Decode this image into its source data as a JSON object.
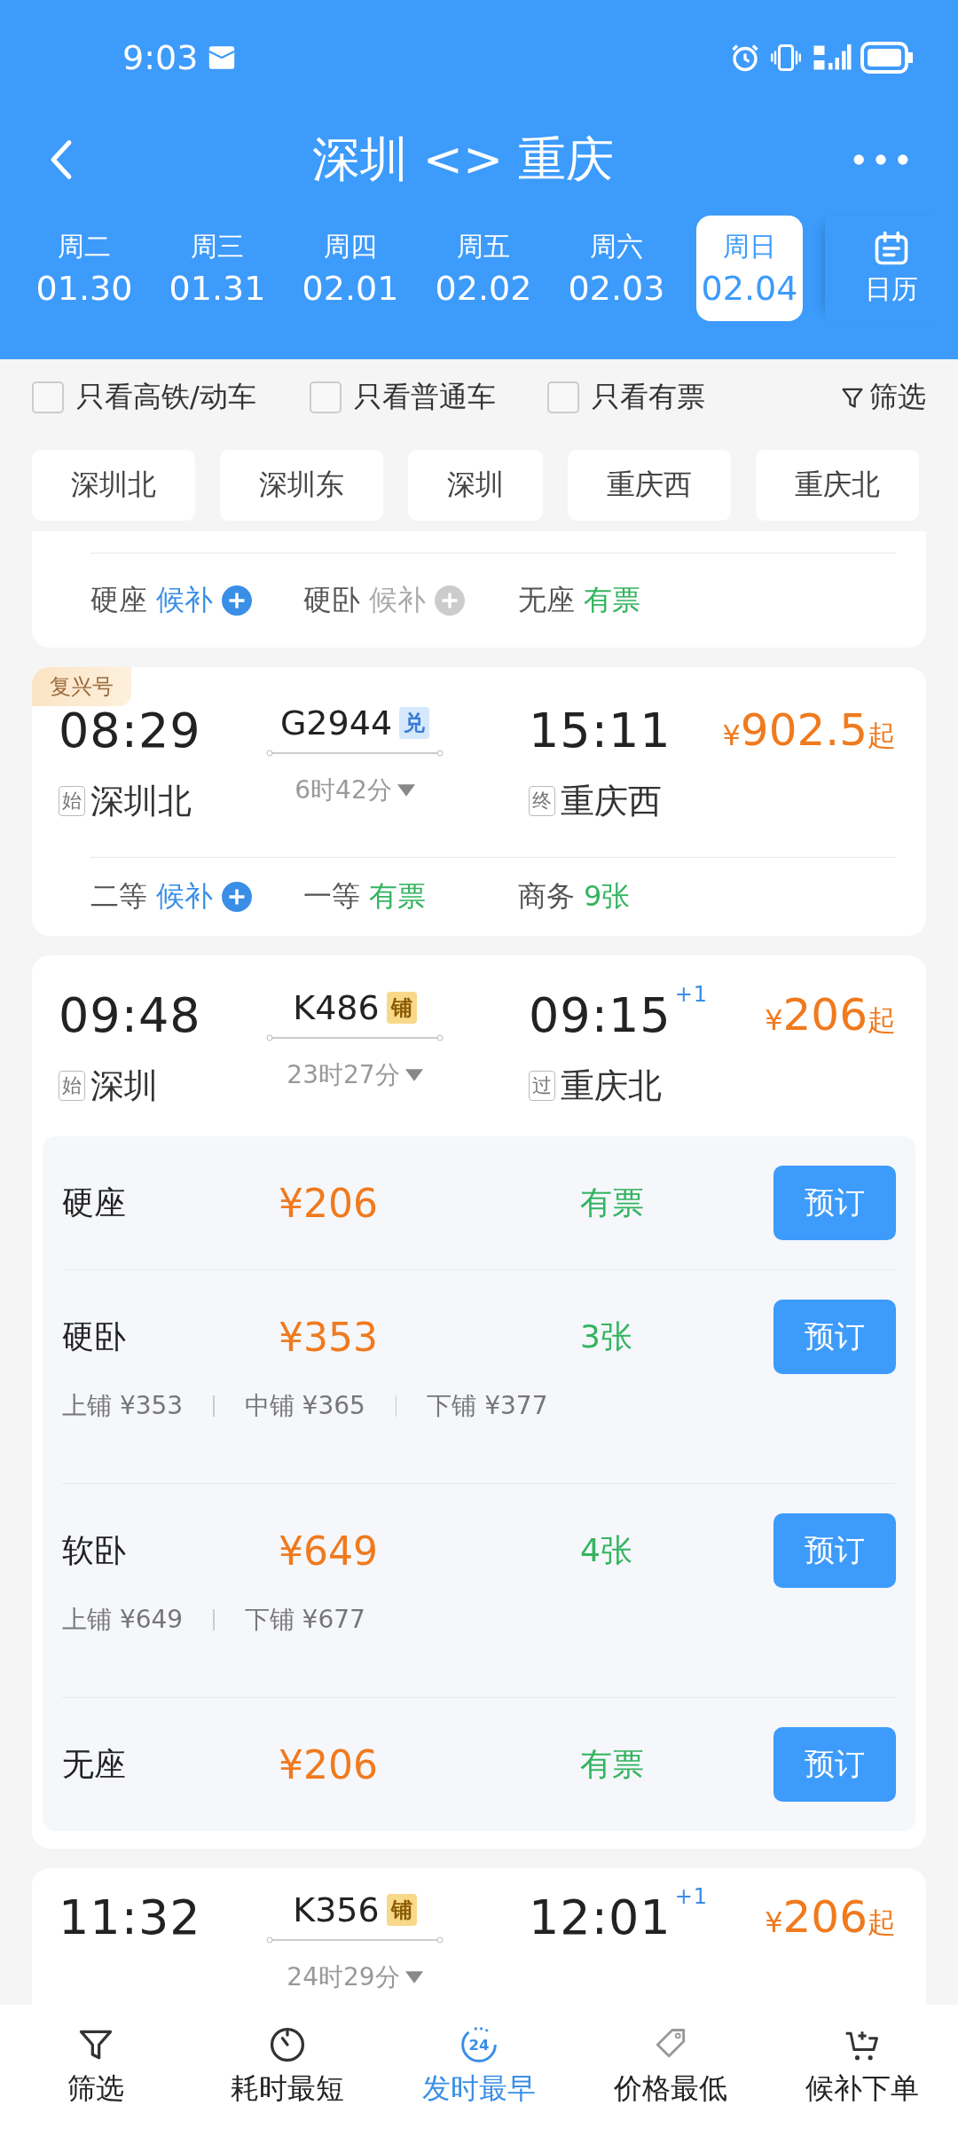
{
  "status_bar": {
    "time": "9:03"
  },
  "header": {
    "title": "深圳 <> 重庆"
  },
  "dates": [
    {
      "weekday": "周二",
      "date": "01.30",
      "selected": false
    },
    {
      "weekday": "周三",
      "date": "01.31",
      "selected": false
    },
    {
      "weekday": "周四",
      "date": "02.01",
      "selected": false
    },
    {
      "weekday": "周五",
      "date": "02.02",
      "selected": false
    },
    {
      "weekday": "周六",
      "date": "02.03",
      "selected": false
    },
    {
      "weekday": "周日",
      "date": "02.04",
      "selected": true
    }
  ],
  "calendar_button": {
    "label": "日历"
  },
  "filters": [
    {
      "label": "只看高铁/动车",
      "checked": false
    },
    {
      "label": "只看普通车",
      "checked": false
    },
    {
      "label": "只看有票",
      "checked": false
    }
  ],
  "filter_button": {
    "label": "筛选"
  },
  "stations": [
    "深圳北",
    "深圳东",
    "深圳",
    "重庆西",
    "重庆北"
  ],
  "trains": [
    {
      "kind": "seats_only",
      "seats": [
        {
          "class": "硬座",
          "status": "候补",
          "kind": "waitlist",
          "disabled": false
        },
        {
          "class": "硬卧",
          "status": "候补",
          "kind": "waitlist",
          "disabled": true
        },
        {
          "class": "无座",
          "status": "有票",
          "kind": "available",
          "disabled": false
        }
      ]
    },
    {
      "kind": "summary",
      "badge": "复兴号",
      "depart": "08:29",
      "number": "G2944",
      "tag": {
        "text": "兑",
        "kind": "exchange"
      },
      "arrive": "15:11",
      "currency": "¥",
      "price": "902.5",
      "suffix": "起",
      "from_mark": "始",
      "from": "深圳北",
      "to_mark": "终",
      "to": "重庆西",
      "duration": "6时42分",
      "seats": [
        {
          "class": "二等",
          "status": "候补",
          "kind": "waitlist",
          "disabled": false
        },
        {
          "class": "一等",
          "status": "有票",
          "kind": "available",
          "disabled": false
        },
        {
          "class": "商务",
          "status": "9张",
          "kind": "available",
          "disabled": false
        }
      ]
    },
    {
      "kind": "expanded",
      "depart": "09:48",
      "number": "K486",
      "tag": {
        "text": "铺",
        "kind": "berth"
      },
      "arrive": "09:15",
      "day_offset": "+1",
      "currency": "¥",
      "price": "206",
      "suffix": "起",
      "from_mark": "始",
      "from": "深圳",
      "to_mark": "过",
      "to": "重庆北",
      "duration": "23时27分",
      "fares": [
        {
          "class": "硬座",
          "price": "¥206",
          "availability": "有票",
          "button": "预订"
        },
        {
          "class": "硬卧",
          "price": "¥353",
          "availability": "3张",
          "button": "预订",
          "berths": [
            "上铺 ¥353",
            "中铺 ¥365",
            "下铺 ¥377"
          ]
        },
        {
          "class": "软卧",
          "price": "¥649",
          "availability": "4张",
          "button": "预订",
          "berths": [
            "上铺 ¥649",
            "下铺 ¥677"
          ]
        },
        {
          "class": "无座",
          "price": "¥206",
          "availability": "有票",
          "button": "预订"
        }
      ]
    },
    {
      "kind": "cut",
      "depart": "11:32",
      "number": "K356",
      "tag": {
        "text": "铺",
        "kind": "berth"
      },
      "arrive": "12:01",
      "day_offset": "+1",
      "currency": "¥",
      "price": "206",
      "suffix": "起",
      "duration": "24时29分"
    }
  ],
  "bottom_nav": [
    {
      "label": "筛选",
      "selected": false
    },
    {
      "label": "耗时最短",
      "selected": false
    },
    {
      "label": "发时最早",
      "selected": true,
      "icon_text": "24"
    },
    {
      "label": "价格最低",
      "selected": false
    },
    {
      "label": "候补下单",
      "selected": false
    }
  ]
}
